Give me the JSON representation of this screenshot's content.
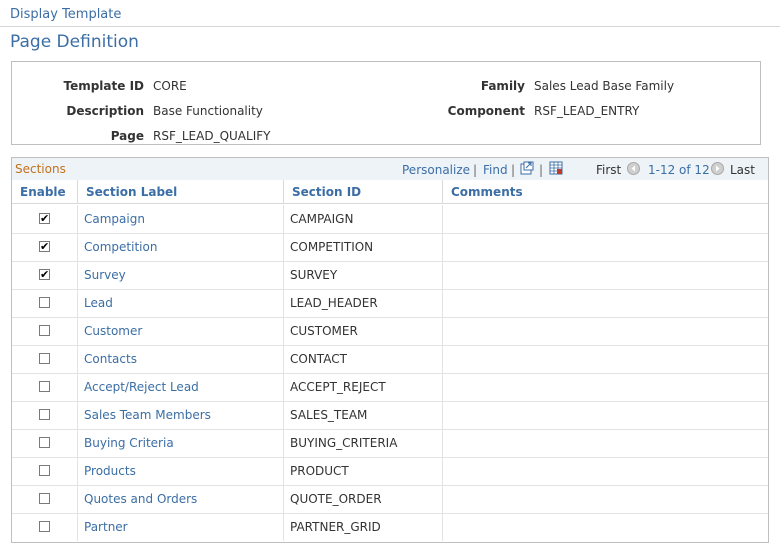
{
  "breadcrumb": "Display Template",
  "page_title": "Page Definition",
  "info": {
    "template_id_label": "Template ID",
    "template_id": "CORE",
    "description_label": "Description",
    "description": "Base Functionality",
    "page_label": "Page",
    "page": "RSF_LEAD_QUALIFY",
    "family_label": "Family",
    "family": "Sales Lead Base Family",
    "component_label": "Component",
    "component": "RSF_LEAD_ENTRY"
  },
  "grid": {
    "title": "Sections",
    "personalize": "Personalize",
    "find": "Find",
    "first": "First",
    "range": "1-12 of 12",
    "last": "Last",
    "columns": {
      "enable": "Enable",
      "section_label": "Section Label",
      "section_id": "Section ID",
      "comments": "Comments"
    },
    "rows": [
      {
        "enabled": true,
        "label": "Campaign",
        "id": "CAMPAIGN",
        "comments": ""
      },
      {
        "enabled": true,
        "label": "Competition",
        "id": "COMPETITION",
        "comments": ""
      },
      {
        "enabled": true,
        "label": "Survey",
        "id": "SURVEY",
        "comments": ""
      },
      {
        "enabled": false,
        "label": "Lead",
        "id": "LEAD_HEADER",
        "comments": ""
      },
      {
        "enabled": false,
        "label": "Customer",
        "id": "CUSTOMER",
        "comments": ""
      },
      {
        "enabled": false,
        "label": "Contacts",
        "id": "CONTACT",
        "comments": ""
      },
      {
        "enabled": false,
        "label": "Accept/Reject Lead",
        "id": "ACCEPT_REJECT",
        "comments": ""
      },
      {
        "enabled": false,
        "label": "Sales Team Members",
        "id": "SALES_TEAM",
        "comments": ""
      },
      {
        "enabled": false,
        "label": "Buying Criteria",
        "id": "BUYING_CRITERIA",
        "comments": ""
      },
      {
        "enabled": false,
        "label": "Products",
        "id": "PRODUCT",
        "comments": ""
      },
      {
        "enabled": false,
        "label": "Quotes and Orders",
        "id": "QUOTE_ORDER",
        "comments": ""
      },
      {
        "enabled": false,
        "label": "Partner",
        "id": "PARTNER_GRID",
        "comments": ""
      }
    ]
  }
}
